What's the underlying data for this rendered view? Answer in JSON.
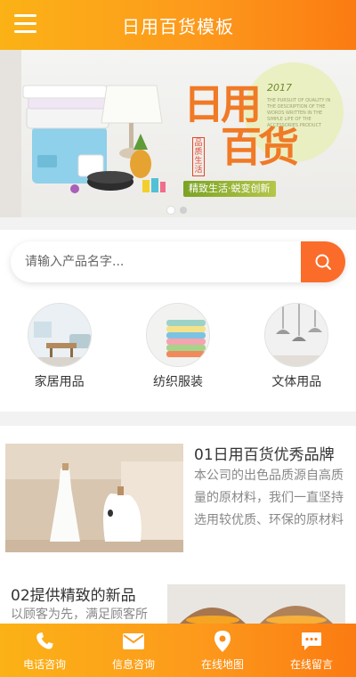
{
  "header": {
    "title": "日用百货模板",
    "menu_icon": "hamburger-menu-icon"
  },
  "banner": {
    "headline_1": "日用",
    "headline_2": "百货",
    "year": "2017",
    "stamp": "品质生活",
    "tagline": "精致生活·蜕变创新",
    "fine_print": "THE PURSUIT OF QUALITY IN THE DESCRIPTION OF THE WORDS WRITTEN IN THE SIMPLE LIFE OF THE ACCESSORIES PRODUCT",
    "slide_count": 2,
    "active_slide": 1
  },
  "search": {
    "placeholder": "请输入产品名字...",
    "value": "",
    "icon": "search-icon"
  },
  "categories": [
    {
      "label": "家居用品",
      "icon": "living-room-image"
    },
    {
      "label": "纺织服装",
      "icon": "folded-towels-image"
    },
    {
      "label": "文体用品",
      "icon": "pendant-lamps-image"
    }
  ],
  "articles": [
    {
      "title": "01日用百货优秀品牌",
      "description": "本公司的出色品质源自高质量的原材料，我们一直坚持选用较优质、环保的原材料"
    },
    {
      "title": "02提供精致的新品",
      "description": "以顾客为先，满足顾客所"
    }
  ],
  "bottom_nav": [
    {
      "label": "电话咨询",
      "icon": "phone-icon"
    },
    {
      "label": "信息咨询",
      "icon": "mail-icon"
    },
    {
      "label": "在线地图",
      "icon": "map-pin-icon"
    },
    {
      "label": "在线留言",
      "icon": "chat-icon"
    }
  ],
  "colors": {
    "accent_start": "#fbb216",
    "accent_end": "#fb7b12",
    "search_button": "#fb6c2a"
  }
}
